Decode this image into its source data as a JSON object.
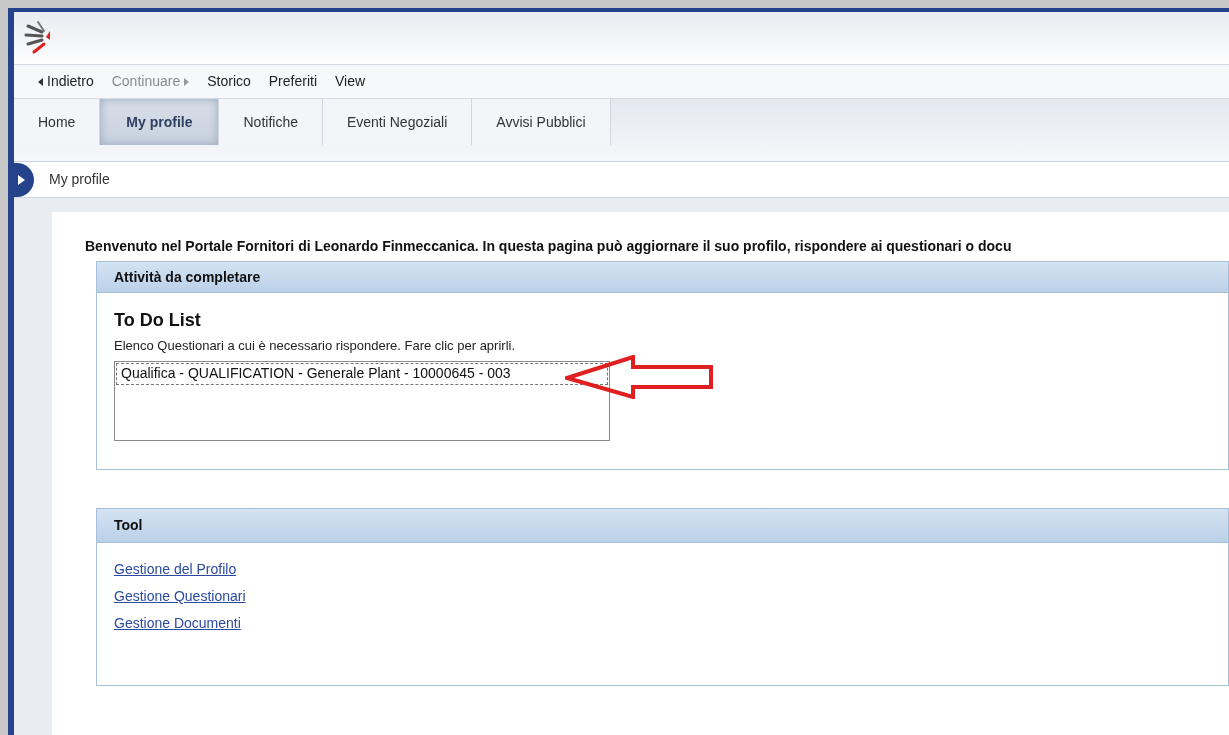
{
  "nav": [
    {
      "label": "Indietro",
      "kind": "back",
      "disabled": false
    },
    {
      "label": "Continuare",
      "kind": "forward",
      "disabled": true
    },
    {
      "label": "Storico",
      "kind": "plain",
      "disabled": false
    },
    {
      "label": "Preferiti",
      "kind": "plain",
      "disabled": false
    },
    {
      "label": "View",
      "kind": "plain",
      "disabled": false
    }
  ],
  "tabs": [
    {
      "label": "Home",
      "selected": false
    },
    {
      "label": "My profile",
      "selected": true
    },
    {
      "label": "Notifiche",
      "selected": false
    },
    {
      "label": "Eventi Negoziali",
      "selected": false
    },
    {
      "label": "Avvisi Pubblici",
      "selected": false
    }
  ],
  "breadcrumb": "My profile",
  "welcome": "Benvenuto nel Portale Fornitori di Leonardo Finmeccanica. In questa pagina può aggiornare il suo profilo, rispondere ai questionari o docu",
  "todo_panel": {
    "title": "Attività da completare",
    "heading": "To Do List",
    "description": "Elenco Questionari a cui è necessario rispondere. Fare clic per aprirli.",
    "items": [
      {
        "label": "Qualifica - QUALIFICATION - Generale Plant - 10000645 - 003",
        "selected": true
      }
    ]
  },
  "tool_panel": {
    "title": "Tool",
    "links": [
      "Gestione del Profilo",
      "Gestione Questionari",
      "Gestione Documenti"
    ]
  }
}
